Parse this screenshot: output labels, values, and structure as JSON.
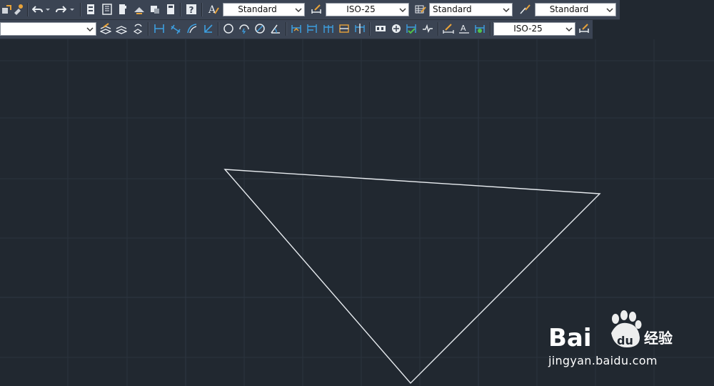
{
  "toolbar_top": {
    "text_style": "Standard",
    "dim_style": "ISO-25",
    "table_style": "Standard",
    "multileader_style": "Standard"
  },
  "toolbar_dim": {
    "dim_style": "ISO-25"
  },
  "watermark": {
    "url": "jingyan.baidu.com"
  },
  "colors": {
    "canvas_bg": "#212830",
    "toolbar_bg": "#3b4453",
    "geometry_stroke": "#e8ecf0",
    "icon_accent": "#3d9fe0"
  }
}
